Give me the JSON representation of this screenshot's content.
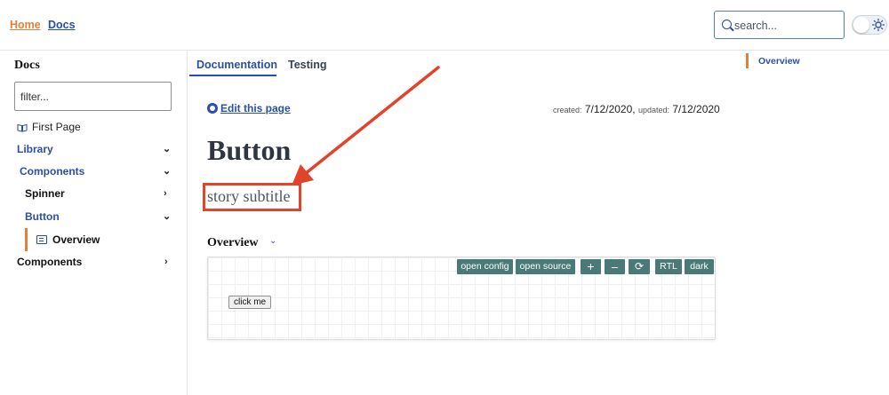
{
  "header": {
    "nav": [
      {
        "label": "Home"
      },
      {
        "label": "Docs"
      }
    ],
    "search": {
      "placeholder": "search..."
    },
    "theme_toggle": {
      "state": "off",
      "icon": "sun-icon"
    }
  },
  "sidebar": {
    "title": "Docs",
    "filter_placeholder": "filter...",
    "items": [
      {
        "label": "First Page",
        "icon": "book-icon"
      },
      {
        "label": "Library",
        "expanded": true
      },
      {
        "label": "Components",
        "expanded": true
      },
      {
        "label": "Spinner",
        "expanded": false
      },
      {
        "label": "Button",
        "expanded": true
      },
      {
        "label": "Overview",
        "icon": "document-icon",
        "active": true
      },
      {
        "label": "Components",
        "expanded": false
      }
    ]
  },
  "tabs": [
    {
      "label": "Documentation",
      "active": true
    },
    {
      "label": "Testing",
      "active": false
    }
  ],
  "main": {
    "edit_link": "Edit this page",
    "created_label": "created:",
    "created_date": "7/12/2020",
    "updated_label": "updated:",
    "updated_date": "7/12/2020",
    "title": "Button",
    "subtitle": "story subtitle",
    "section_title": "Overview",
    "toolbar": [
      "open config",
      "open source",
      "+",
      "–",
      "⟳",
      "RTL",
      "dark"
    ],
    "story_button": "click me"
  },
  "toc": {
    "items": [
      {
        "label": "Overview"
      }
    ]
  },
  "colors": {
    "accent": "#2a4fa8",
    "orange": "#e0803b",
    "highlight": "#e0442b",
    "toolbar": "#4a7a77"
  }
}
